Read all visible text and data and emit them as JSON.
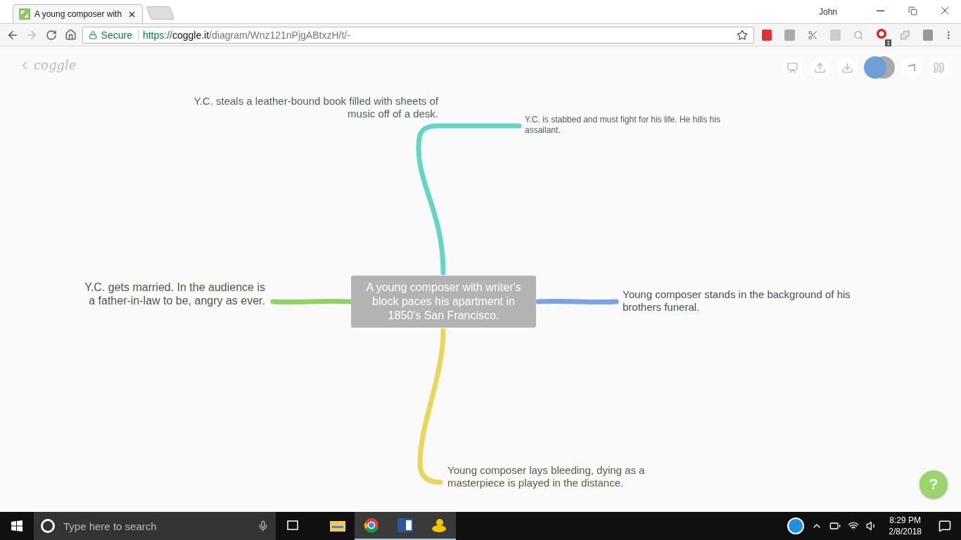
{
  "browser": {
    "tab_title": "A young composer with",
    "profile": "John",
    "address": {
      "secure_label": "Secure",
      "url_scheme": "https://",
      "url_host": "coggle.it",
      "url_path": "/diagram/Wnz121nPjgABtxzH/t/-"
    },
    "extension_badge": "1"
  },
  "app": {
    "logo": "coggle"
  },
  "mindmap": {
    "root": "A young composer with writer's block paces his apartment in 1850's San Francisco.",
    "branches": [
      {
        "kind": "up",
        "color": "#66d6c4",
        "texts": [
          "Y.C. steals a leather-bound book filled with sheets of music off of a desk.",
          "Y.C. is stabbed and must fight for his life. He hills his assailant."
        ]
      },
      {
        "kind": "left",
        "color": "#93d165",
        "texts": [
          "Y.C. gets married. In the audience is a father-in-law to be, angry as ever."
        ]
      },
      {
        "kind": "right",
        "color": "#7aa3e5",
        "texts": [
          "Young composer stands in the background of his brothers funeral."
        ]
      },
      {
        "kind": "down",
        "color": "#e8d75a",
        "texts": [
          "Young composer lays bleeding, dying as a masterpiece is played in the distance."
        ]
      }
    ]
  },
  "help_button": "?",
  "taskbar": {
    "search_placeholder": "Type here to search",
    "time": "8:29 PM",
    "date": "2/8/2018"
  }
}
